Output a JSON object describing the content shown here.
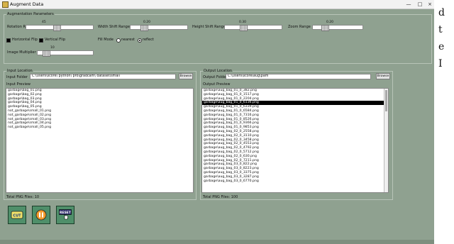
{
  "window": {
    "title": "Augment Data",
    "minimize": "—",
    "maximize": "□",
    "close": "×"
  },
  "side_text": [
    "d",
    "t",
    "e",
    "I"
  ],
  "augmentation": {
    "group_label": "Augmentation Parameters",
    "rotation": {
      "label": "Rotation Range",
      "value": "45",
      "fraction": 0.45
    },
    "width_shift": {
      "label": "Width Shift Range",
      "value": "0.20",
      "fraction": 0.2
    },
    "height_shift": {
      "label": "Height Shift Range",
      "value": "0.30",
      "fraction": 0.3
    },
    "zoom": {
      "label": "Zoom Range",
      "value": "0.20",
      "fraction": 0.2
    },
    "h_flip": {
      "label": "Horizontal Flip",
      "checked": true
    },
    "v_flip": {
      "label": "Vertical Flip",
      "checked": true
    },
    "fill_mode": {
      "label": "Fill Mode",
      "options": [
        "nearest",
        "reflect"
      ],
      "selected": "reflect"
    },
    "multiplier": {
      "label": "Image Multiplier",
      "value": "10",
      "fraction": 0.1
    }
  },
  "input": {
    "group_label": "Input Location",
    "folder_label": "Input Folder",
    "folder_value": "C:\\Users\\score\\ python\\ pro\\gradcam\\ dataset\\small",
    "browse": "Browse",
    "preview_label": "Input Preview",
    "files": [
      "garbage\\bag_01.png",
      "garbage\\bag_02.png",
      "garbage\\bag_03.png",
      "garbage\\bag_04.png",
      "garbage\\bag_05.png",
      "not_garbage\\small_01.png",
      "not_garbage\\small_02.png",
      "not_garbage\\small_03.png",
      "not_garbage\\small_04.png",
      "not_garbage\\small_05.png"
    ],
    "total_label": "Total PNG Files:",
    "total_value": "10"
  },
  "output": {
    "group_label": "Output Location",
    "folder_label": "Output Folder",
    "folder_value": "C:\\Users\\score\\aug\\pam",
    "browse": "Browse",
    "preview_label": "Output Preview",
    "files": [
      "garbage\\aug_bag_01_0_382.png",
      "garbage\\aug_bag_01_0_1517.png",
      "garbage\\aug_bag_01_0_2204.png",
      "garbage\\aug_bag_01_0_6136.png",
      "garbage\\aug_bag_01_0_6339.png",
      "garbage\\aug_bag_01_0_6584.png",
      "garbage\\aug_bag_01_0_7316.png",
      "garbage\\aug_bag_01_0_8526.png",
      "garbage\\aug_bag_01_0_9366.png",
      "garbage\\aug_bag_01_0_9853.png",
      "garbage\\aug_bag_02_0_2558.png",
      "garbage\\aug_bag_02_0_3110.png",
      "garbage\\aug_bag_02_0_3458.png",
      "garbage\\aug_bag_02_0_4553.png",
      "garbage\\aug_bag_02_0_4792.png",
      "garbage\\aug_bag_02_0_5712.png",
      "garbage\\aug_bag_02_0_630.png",
      "garbage\\aug_bag_02_0_7211.png",
      "garbage\\aug_bag_03_0_822.png",
      "garbage\\aug_bag_03_0_8223.png",
      "garbage\\aug_bag_03_0_3375.png",
      "garbage\\aug_bag_03_0_3287.png",
      "garbage\\aug_bag_03_0_6770.png"
    ],
    "selected_index": 3,
    "total_label": "Total PNG Files:",
    "total_value": "100"
  },
  "actions": {
    "cut_label": "CUT",
    "reset_label": "RESET"
  },
  "colors": {
    "window_bg": "#8fa190",
    "button_bg": "#4f8f6a",
    "selection": "#000000"
  }
}
